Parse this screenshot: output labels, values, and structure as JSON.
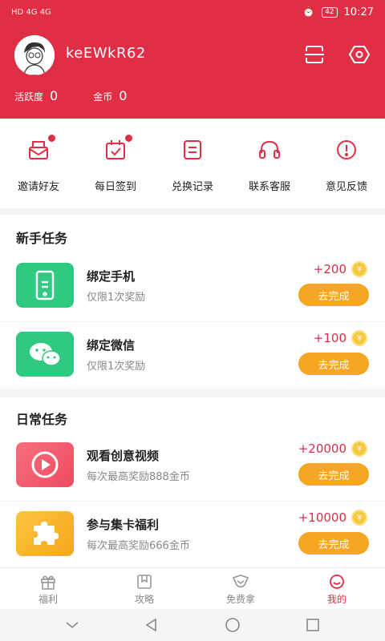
{
  "status_bar": {
    "left": "HD 4G 4G",
    "battery": "42",
    "time": "10:27"
  },
  "profile": {
    "username": "keEWkR62",
    "activity_label": "活跃度",
    "activity_value": "0",
    "coins_label": "金币",
    "coins_value": "0"
  },
  "quick_actions": [
    {
      "label": "邀请好友",
      "icon": "envelope-icon",
      "dot": true
    },
    {
      "label": "每日签到",
      "icon": "calendar-check-icon",
      "dot": true
    },
    {
      "label": "兑换记录",
      "icon": "document-icon",
      "dot": false
    },
    {
      "label": "联系客服",
      "icon": "headset-icon",
      "dot": false
    },
    {
      "label": "意见反馈",
      "icon": "alert-icon",
      "dot": false
    }
  ],
  "newbie": {
    "title": "新手任务",
    "tasks": [
      {
        "title": "绑定手机",
        "subtitle": "仅限1次奖励",
        "reward": "+200",
        "button": "去完成",
        "icon": "phone-icon",
        "color": "#2fc980"
      },
      {
        "title": "绑定微信",
        "subtitle": "仅限1次奖励",
        "reward": "+100",
        "button": "去完成",
        "icon": "wechat-icon",
        "color": "#2fc980"
      }
    ]
  },
  "daily": {
    "title": "日常任务",
    "tasks": [
      {
        "title": "观看创意视频",
        "subtitle": "每次最高奖励888金币",
        "reward": "+20000",
        "button": "去完成",
        "icon": "play-icon",
        "color": "#f0566a"
      },
      {
        "title": "参与集卡福利",
        "subtitle": "每次最高奖励666金币",
        "reward": "+10000",
        "button": "去完成",
        "icon": "puzzle-icon",
        "color": "#f8b31e"
      }
    ]
  },
  "coin_symbol": "¥",
  "tabs": [
    {
      "label": "福利",
      "icon": "gift-icon",
      "active": false
    },
    {
      "label": "攻略",
      "icon": "book-icon",
      "active": false
    },
    {
      "label": "免费拿",
      "icon": "tag-icon",
      "active": false
    },
    {
      "label": "我的",
      "icon": "smile-icon",
      "active": true
    }
  ],
  "accent_color": "#e02f44"
}
